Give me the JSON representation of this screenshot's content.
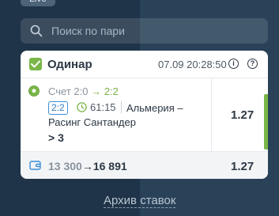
{
  "live_tab": {
    "label": "Live"
  },
  "search": {
    "placeholder": "Поиск по пари",
    "icon": "search-icon"
  },
  "bet": {
    "type_label": "Одинар",
    "datetime": "07.09 20:28:50",
    "score_prefix": "Счет",
    "score_old": "2:0",
    "score_arrow": "→",
    "score_new": "2:2",
    "current_score": "2:2",
    "match_time": "61:15",
    "teams": "Альмерия – Расинг Сантандер",
    "outcome": "> 3",
    "odds": "1.27",
    "accent_color": "#7ab648"
  },
  "summary": {
    "amount_from": "13 300",
    "arrow": "→",
    "amount_to": "16 891",
    "odds": "1.27"
  },
  "archive_link": {
    "label": "Архив ставок"
  }
}
